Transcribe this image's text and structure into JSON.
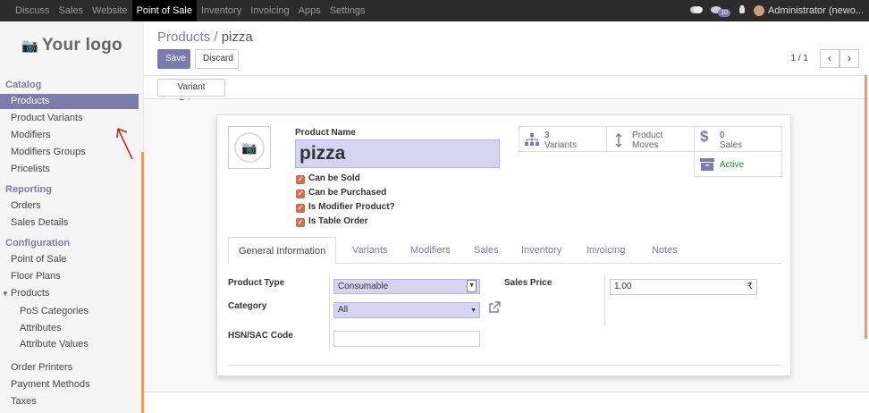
{
  "topbar": {
    "menu": [
      "Discuss",
      "Sales",
      "Website",
      "Point of Sale",
      "Inventory",
      "Invoicing",
      "Apps",
      "Settings"
    ],
    "active_menu": "Point of Sale",
    "activity_badge": "10",
    "user": "Administrator (newo..."
  },
  "sidebar": {
    "logo": "Your logo",
    "sections": [
      {
        "title": "Catalog",
        "items": [
          "Products",
          "Product Variants",
          "Modifiers",
          "Modifiers Groups",
          "Pricelists"
        ]
      },
      {
        "title": "Reporting",
        "items": [
          "Orders",
          "Sales Details"
        ]
      },
      {
        "title": "Configuration",
        "items": [
          "Point of Sale",
          "Floor Plans",
          "Products",
          "PoS Categories",
          "Attributes",
          "Attribute Values",
          "Order Printers",
          "Payment Methods",
          "Taxes"
        ]
      }
    ],
    "selected": "Products"
  },
  "header": {
    "breadcrumb_parent": "Products /",
    "breadcrumb_current": "pizza",
    "save_label": "Save",
    "discard_label": "Discard",
    "pager": "1 / 1",
    "variant_prices_label": "Variant Prices"
  },
  "form": {
    "product_name_label": "Product Name",
    "product_name": "pizza",
    "checkboxes": [
      "Can be Sold",
      "Can be Purchased",
      "Is Modifier Product?",
      "Is Table Order"
    ],
    "smart_buttons": {
      "variants_count": "3",
      "variants_label": "Variants",
      "moves_label1": "Product",
      "moves_label2": "Moves",
      "sales_count": "0",
      "sales_label": "Sales",
      "active_label": "Active"
    },
    "tabs": [
      "General Information",
      "Variants",
      "Modifiers",
      "Sales",
      "Inventory",
      "Invoicing",
      "Notes"
    ],
    "active_tab": "General Information",
    "product_type_label": "Product Type",
    "product_type": "Consumable",
    "category_label": "Category",
    "category": "All",
    "hsn_label": "HSN/SAC Code",
    "hsn_value": "",
    "sales_price_label": "Sales Price",
    "sales_price": "1.00",
    "currency_symbol": "₹"
  },
  "colors": {
    "accent": "#7c7bad",
    "topbar": "#2b2b2b",
    "orange": "#f19a66",
    "checkbox": "#d9694c",
    "edit_field": "#d6d4f1"
  }
}
